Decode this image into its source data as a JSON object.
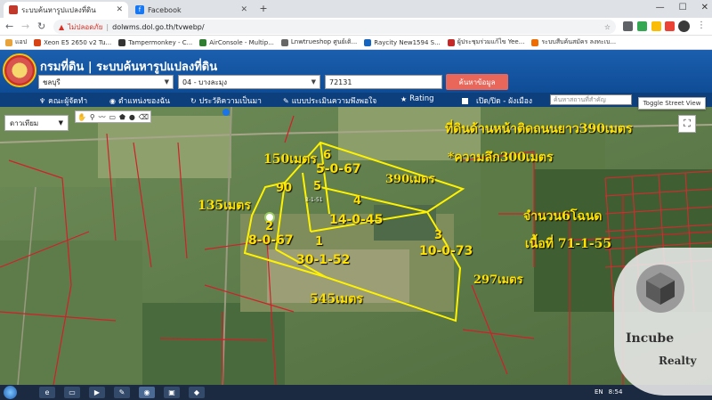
{
  "browser": {
    "tabs": [
      {
        "title": "ระบบค้นหารูปแปลงที่ดิน",
        "active": true
      },
      {
        "title": "Facebook",
        "active": false
      }
    ],
    "new_tab": "+",
    "window_controls": [
      "—",
      "☐",
      "✕"
    ],
    "address": {
      "security": "ไม่ปลอดภัย",
      "url": "dolwms.dol.go.th/tvwebp/"
    },
    "bookmarks": [
      {
        "label": "แอป",
        "color": "#e8a33c"
      },
      {
        "label": "Xeon E5 2650 v2 Tu...",
        "color": "#d84315"
      },
      {
        "label": "Tampermonkey - C...",
        "color": "#333333"
      },
      {
        "label": "AirConsole - Multip...",
        "color": "#2e7d32"
      },
      {
        "label": "Lnwtrueshop ศูนย์เติ...",
        "color": "#666666"
      },
      {
        "label": "Raycity New1594 S...",
        "color": "#1565c0"
      },
      {
        "label": "ผู้ประชุมร่วมแก้ไข Yee...",
        "color": "#c62828"
      },
      {
        "label": "ระบบสืบค้นสมัคร ลงทะเบ...",
        "color": "#ef6c00"
      }
    ]
  },
  "site": {
    "title": "กรมที่ดิน | ระบบค้นหารูปแปลงที่ดิน",
    "province": "ชลบุรี",
    "district": "04 - บางละมุง",
    "parcel": "72131",
    "search_label": "ค้นหาข้อมูล"
  },
  "menu": {
    "items": [
      {
        "icon": "♆",
        "label": "คณะผู้จัดทำ"
      },
      {
        "icon": "◉",
        "label": "ตำแหน่งของฉัน"
      },
      {
        "icon": "↻",
        "label": "ประวัติความเป็นมา"
      },
      {
        "icon": "✎",
        "label": "แบบประเมินความพึงพอใจ"
      },
      {
        "icon": "★",
        "label": "Rating"
      },
      {
        "icon": "",
        "label": "เปิด/ปิด - ผังเมือง"
      }
    ],
    "place_placeholder": "ค้นหาสถานที่สำคัญ",
    "street_view": "Toggle Street View"
  },
  "map": {
    "basemap": "ดาวเทียม",
    "draw_tools": [
      "✋",
      "⚲",
      "〰",
      "▭",
      "⬟",
      "●",
      "⌫"
    ],
    "fullscreen": "⛶",
    "annotations": {
      "front_road": "ที่ดินด้านหน้าติดถนนยาว390เมตร",
      "depth": "*ความลึก300เมตร",
      "parcel_count": "จำนวน6โฉนด",
      "area_total": "เนื้อที่ 71-1-55",
      "dim_150": "150เมตร",
      "dim_390": "390เมตร",
      "dim_135": "135เมตร",
      "dim_545": "545เมตร",
      "dim_297": "297เมตร",
      "dim_90": "90"
    },
    "parcels": [
      {
        "no": "1",
        "area": "30-1-52"
      },
      {
        "no": "2",
        "area": "8-0-67"
      },
      {
        "no": "3",
        "area": "10-0-73"
      },
      {
        "no": "4",
        "area": "14-0-45"
      },
      {
        "no": "5",
        "area": "3-1-51"
      },
      {
        "no": "6",
        "area": "5-0-67"
      }
    ]
  },
  "watermark": {
    "line1": "Incube",
    "line2": "Realty"
  },
  "taskbar": {
    "lang": "EN",
    "clock": "8:54"
  }
}
